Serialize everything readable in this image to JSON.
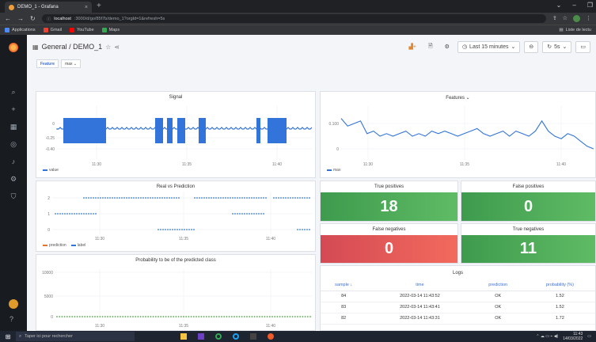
{
  "browser": {
    "tab_title": "DEMO_1 - Grafana",
    "new_tab": "+",
    "url_host": "localhost",
    "url_rest": ":3000/d/go/85f7b/demo_1?orgId=1&refresh=5s",
    "bookmarks": [
      {
        "label": "Applications",
        "color": "#4c8bf5"
      },
      {
        "label": "Gmail",
        "color": "#ea4335"
      },
      {
        "label": "YouTube",
        "color": "#ff0000"
      },
      {
        "label": "Maps",
        "color": "#34a853"
      }
    ],
    "bookmarks_right": "Liste de lectu"
  },
  "dashboard": {
    "breadcrumb": "General / DEMO_1",
    "time_range": "Last 15 minutes",
    "refresh": "5s"
  },
  "variables": {
    "label": "Feature",
    "value": "max"
  },
  "panels": {
    "signal": {
      "title": "Signal",
      "legend": "value"
    },
    "features": {
      "title": "Features",
      "legend": "max"
    },
    "real_vs_pred": {
      "title": "Real vs Prediction",
      "legend": [
        "prediction",
        "label"
      ]
    },
    "probability": {
      "title": "Probability to be of the predicted class"
    }
  },
  "stats": [
    {
      "title": "True positives",
      "value": "18",
      "color": "green"
    },
    {
      "title": "False positives",
      "value": "0",
      "color": "green"
    },
    {
      "title": "False negatives",
      "value": "0",
      "color": "red"
    },
    {
      "title": "True negatives",
      "value": "11",
      "color": "green"
    }
  ],
  "logs": {
    "title": "Logs",
    "columns": [
      "sample",
      "time",
      "prediction",
      "probability (%)"
    ],
    "rows": [
      [
        "84",
        "2022-03-14 11:43:52",
        "OK",
        "1.52"
      ],
      [
        "83",
        "2022-03-14 11:43:41",
        "OK",
        "1.52"
      ],
      [
        "82",
        "2022-03-14 11:43:31",
        "OK",
        "1.72"
      ]
    ]
  },
  "taskbar": {
    "search": "Taper ici pour rechercher",
    "time": "11:43",
    "date": "14/03/2022"
  },
  "chart_data": [
    {
      "type": "area",
      "title": "Signal",
      "x_ticks": [
        "11:30",
        "11:35",
        "11:40"
      ],
      "y_ticks": [
        "0",
        "-0.25",
        "-0.40"
      ],
      "series": [
        {
          "name": "value"
        }
      ]
    },
    {
      "type": "line",
      "title": "Features",
      "x_ticks": [
        "11:30",
        "11:35",
        "11:40"
      ],
      "y_ticks": [
        "0.100",
        "0"
      ],
      "series": [
        {
          "name": "max",
          "values": [
            0.12,
            0.09,
            0.1,
            0.11,
            0.06,
            0.07,
            0.05,
            0.06,
            0.05,
            0.06,
            0.07,
            0.05,
            0.06,
            0.05,
            0.07,
            0.06,
            0.07,
            0.06,
            0.05,
            0.06,
            0.07,
            0.08,
            0.06,
            0.05,
            0.06,
            0.07,
            0.05,
            0.07,
            0.06,
            0.05,
            0.07,
            0.11,
            0.07,
            0.05,
            0.04,
            0.06,
            0.05,
            0.03,
            0.01,
            0.0
          ]
        }
      ]
    },
    {
      "type": "scatter",
      "title": "Real vs Prediction",
      "x_ticks": [
        "11:30",
        "11:35",
        "11:40"
      ],
      "y_ticks": [
        "2",
        "1",
        "0"
      ],
      "series": [
        {
          "name": "prediction"
        },
        {
          "name": "label"
        }
      ]
    },
    {
      "type": "scatter",
      "title": "Probability to be of the predicted class",
      "x_ticks": [
        "11:30",
        "11:35",
        "11:40"
      ],
      "y_ticks": [
        "10000",
        "5000",
        "0"
      ]
    }
  ]
}
